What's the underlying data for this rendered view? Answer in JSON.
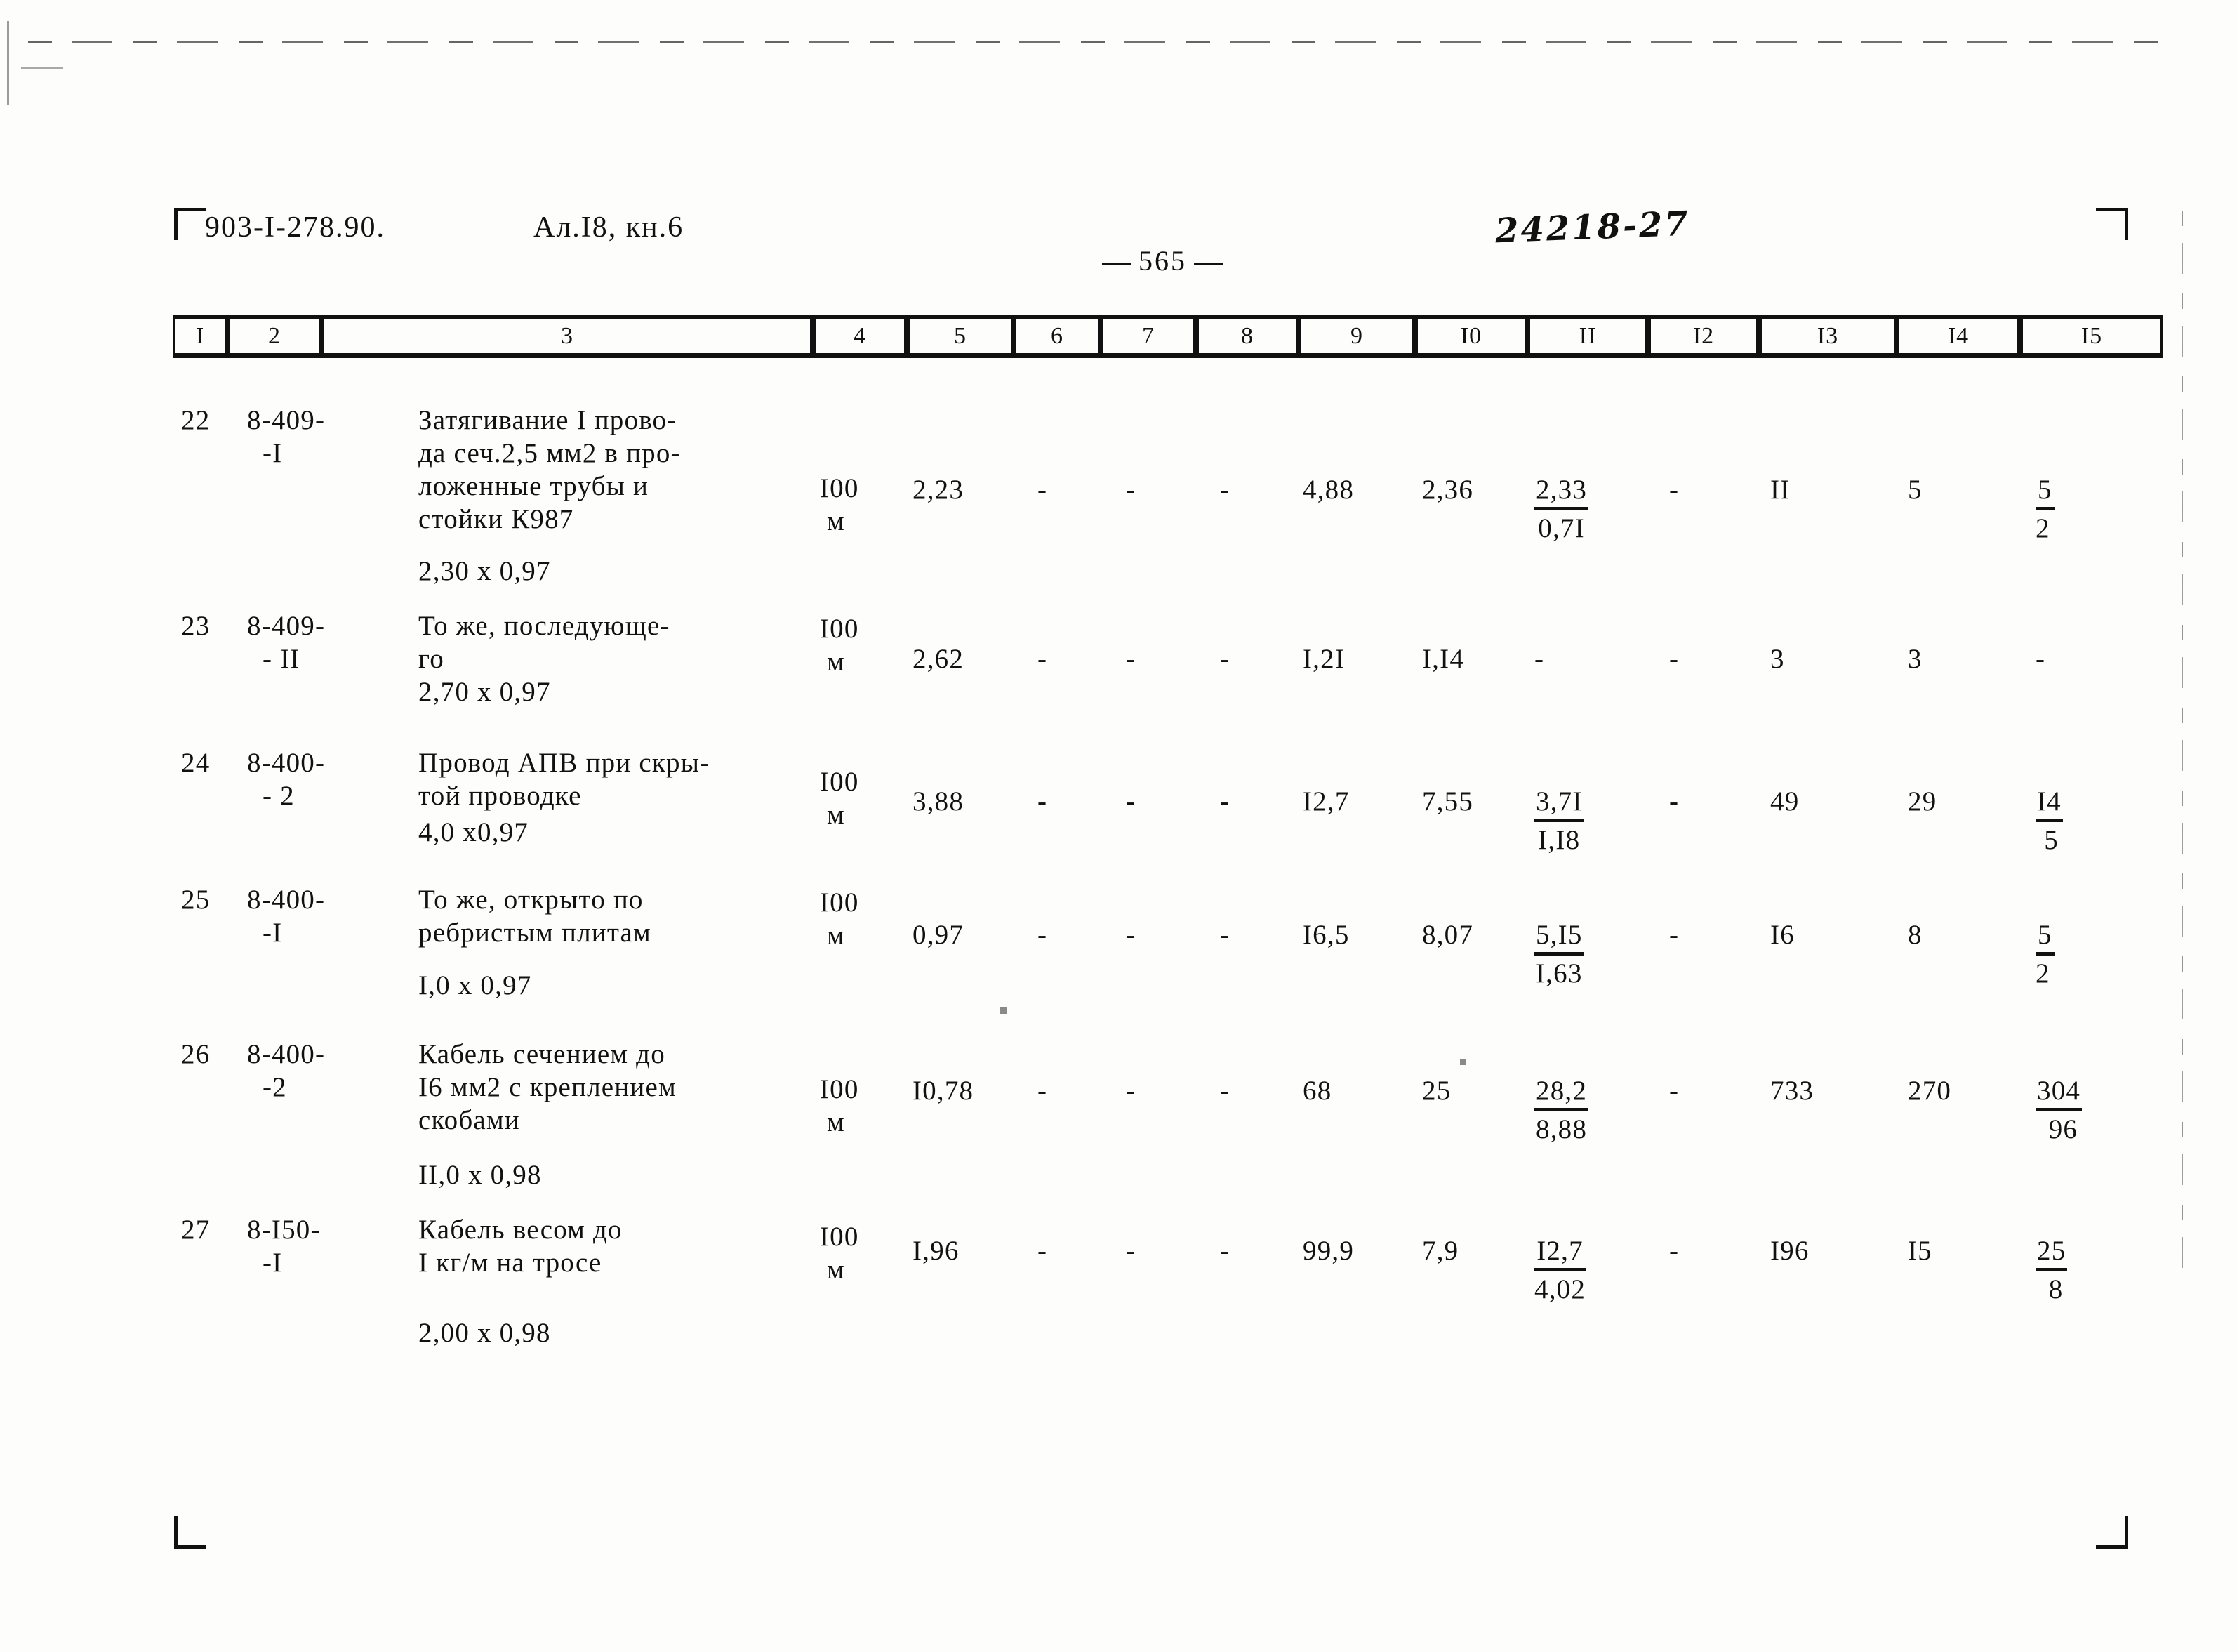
{
  "header": {
    "doc_code": "903-I-278.90.",
    "album": "Ал.I8, кн.6",
    "page_number": "565",
    "handwritten_note": "24218-27"
  },
  "table": {
    "column_headers": [
      "I",
      "2",
      "3",
      "4",
      "5",
      "6",
      "7",
      "8",
      "9",
      "I0",
      "II",
      "I2",
      "I3",
      "I4",
      "I5"
    ],
    "rows": [
      {
        "num": "22",
        "code_line1": "8-409-",
        "code_line2": "-I",
        "desc_lines": [
          "Затягивание I прово-",
          "да сеч.2,5 мм2 в про-",
          "ложенные трубы и",
          "стойки К987"
        ],
        "multiplier": "2,30 х 0,97",
        "unit_line1": "I00",
        "unit_line2": "м",
        "c5": "2,23",
        "c6": "-",
        "c7": "-",
        "c8": "-",
        "c9": "4,88",
        "c10": "2,36",
        "c11_top": "2,33",
        "c11_bot": "0,7I",
        "c12": "-",
        "c13": "II",
        "c14": "5",
        "c15_top": "5",
        "c15_bot": "2"
      },
      {
        "num": "23",
        "code_line1": "8-409-",
        "code_line2": "- II",
        "desc_lines": [
          "То же, последующе-",
          "го"
        ],
        "multiplier": "2,70 х 0,97",
        "unit_line1": "I00",
        "unit_line2": "м",
        "c5": "2,62",
        "c6": "-",
        "c7": "-",
        "c8": "-",
        "c9": "I,2I",
        "c10": "I,I4",
        "c11_top": "-",
        "c11_bot": "",
        "c12": "-",
        "c13": "3",
        "c14": "3",
        "c15_top": "-",
        "c15_bot": ""
      },
      {
        "num": "24",
        "code_line1": "8-400-",
        "code_line2": "- 2",
        "desc_lines": [
          "Провод АПВ при скры-",
          "той проводке"
        ],
        "multiplier": "4,0 х0,97",
        "unit_line1": "I00",
        "unit_line2": "м",
        "c5": "3,88",
        "c6": "-",
        "c7": "-",
        "c8": "-",
        "c9": "I2,7",
        "c10": "7,55",
        "c11_top": "3,7I",
        "c11_bot": "I,I8",
        "c12": "-",
        "c13": "49",
        "c14": "29",
        "c15_top": "I4",
        "c15_bot": "5"
      },
      {
        "num": "25",
        "code_line1": "8-400-",
        "code_line2": "-I",
        "desc_lines": [
          "То же, открыто по",
          "ребристым плитам"
        ],
        "multiplier": "I,0 х 0,97",
        "unit_line1": "I00",
        "unit_line2": "м",
        "c5": "0,97",
        "c6": "-",
        "c7": "-",
        "c8": "-",
        "c9": "I6,5",
        "c10": "8,07",
        "c11_top": "5,I5",
        "c11_bot": "I,63",
        "c12": "-",
        "c13": "I6",
        "c14": "8",
        "c15_top": "5",
        "c15_bot": "2"
      },
      {
        "num": "26",
        "code_line1": "8-400-",
        "code_line2": "-2",
        "desc_lines": [
          "Кабель сечением до",
          "I6 мм2 с креплением",
          "скобами"
        ],
        "multiplier": "II,0 х 0,98",
        "unit_line1": "I00",
        "unit_line2": "м",
        "c5": "I0,78",
        "c6": "-",
        "c7": "-",
        "c8": "-",
        "c9": "68",
        "c10": "25",
        "c11_top": "28,2",
        "c11_bot": "8,88",
        "c12": "-",
        "c13": "733",
        "c14": "270",
        "c15_top": "304",
        "c15_bot": "96"
      },
      {
        "num": "27",
        "code_line1": "8-I50-",
        "code_line2": "-I",
        "desc_lines": [
          "Кабель весом до",
          "I кг/м на тросе"
        ],
        "multiplier": "2,00 х 0,98",
        "unit_line1": "I00",
        "unit_line2": "м",
        "c5": "I,96",
        "c6": "-",
        "c7": "-",
        "c8": "-",
        "c9": "99,9",
        "c10": "7,9",
        "c11_top": "I2,7",
        "c11_bot": "4,02",
        "c12": "-",
        "c13": "I96",
        "c14": "I5",
        "c15_top": "25",
        "c15_bot": "8"
      }
    ]
  }
}
